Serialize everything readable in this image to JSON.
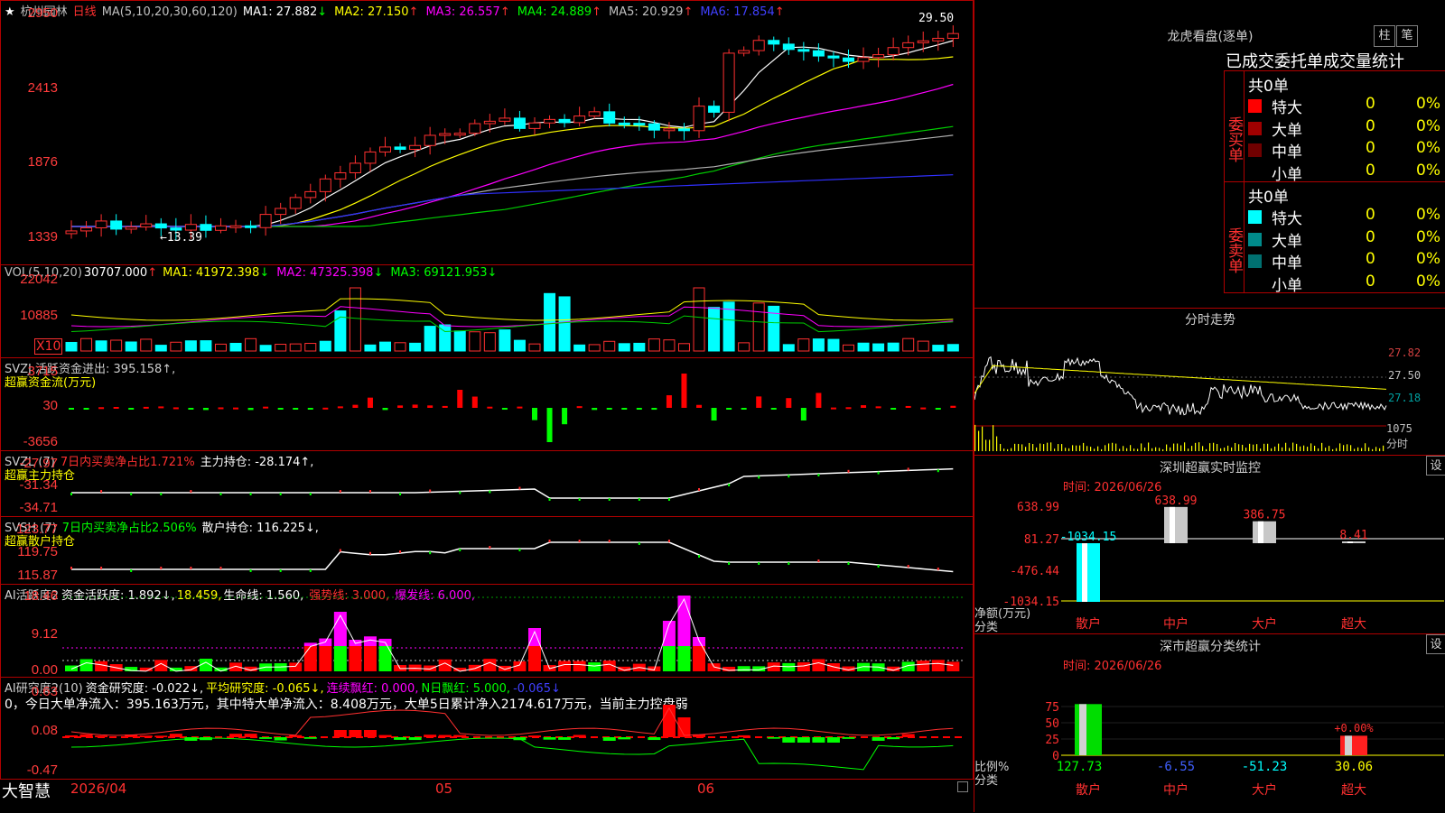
{
  "stock": {
    "name": "杭州园林",
    "period": "日线",
    "star": "★"
  },
  "ma_header": {
    "label": "MA(5,10,20,30,60,120)",
    "items": [
      {
        "text": "MA1: 27.882",
        "arrow": "↓",
        "color": "#ffffff"
      },
      {
        "text": "MA2: 27.150",
        "arrow": "↑",
        "color": "#ffff00"
      },
      {
        "text": "MA3: 26.557",
        "arrow": "↑",
        "color": "#ff00ff"
      },
      {
        "text": "MA4: 24.889",
        "arrow": "↑",
        "color": "#00ff00"
      },
      {
        "text": "MA5: 20.929",
        "arrow": "↑",
        "color": "#c0c0c0"
      },
      {
        "text": "MA6: 17.854",
        "arrow": "↑",
        "color": "#4040ff"
      }
    ],
    "high_mark": "29.50",
    "low_mark": "←13.39"
  },
  "price_axis": [
    "2950",
    "2413",
    "1876",
    "1339"
  ],
  "vol_header": {
    "label": "VOL(5,10,20)",
    "value": "30707.000",
    "arrow": "↑",
    "items": [
      {
        "text": "MA1: 41972.398",
        "arrow": "↓",
        "color": "#ffff00"
      },
      {
        "text": "MA2: 47325.398",
        "arrow": "↓",
        "color": "#ff00ff"
      },
      {
        "text": "MA3: 69121.953",
        "arrow": "↓",
        "color": "#00ff00"
      }
    ]
  },
  "vol_axis": [
    "22042",
    "10885"
  ],
  "vol_unit": "X10",
  "svzj": {
    "line1": "SVZJ  活跃资金进出: 395.158↑,",
    "line2": "超赢资金流(万元)",
    "axis": [
      "3715",
      "30",
      "-3656"
    ]
  },
  "svzl": {
    "line1a": "SVZL (7)",
    "line1b": "7日内买卖净占比1.721%",
    "line1c": "主力持仓: -28.174↑,",
    "line2": "超赢主力持仓",
    "axis": [
      "-27.97",
      "-31.34",
      "-34.71"
    ]
  },
  "svsh": {
    "line1a": "SVSH (7)",
    "line1b": "7日内买卖净占比2.506%",
    "line1c": "散户持仓: 116.225↓,",
    "line2": "超赢散户持仓",
    "axis": [
      "123.77",
      "119.75",
      "115.87"
    ]
  },
  "ai1": {
    "a": "AI活跃度2",
    "b": "资金活跃度: 1.892↓,",
    "c": "18.459,",
    "d": "生命线: 1.560,",
    "e": "强势线: 3.000,",
    "f": "爆发线: 6.000,",
    "axis": [
      "18.46",
      "9.12",
      "0.00"
    ]
  },
  "ai2": {
    "a": "AI研究度2(10)",
    "b": "资金研究度: -0.022↓,",
    "c": "平均研究度: -0.065↓,",
    "d": "连续飘红: 0.000,",
    "e": "N日飘红: 5.000,",
    "f": "-0.065↓",
    "line2": "0，今日大单净流入：395.163万元，其中特大单净流入：8.408万元，大单5日累计净入2174.617万元，当前主力控盘弱",
    "axis": [
      "0.63",
      "0.08",
      "-0.47"
    ]
  },
  "bottom": {
    "brand": "大智慧",
    "date": "2026/04",
    "m05": "05",
    "m06": "06"
  },
  "lhb": {
    "title": "龙虎看盘(逐单)",
    "btn1": "柱",
    "btn2": "笔",
    "subtitle": "已成交委托单成交量统计",
    "buy": {
      "label": "委买单",
      "total": "共0单",
      "rows": [
        {
          "name": "特大",
          "v": "0",
          "p": "0%",
          "color": "#ff0000"
        },
        {
          "name": "大单",
          "v": "0",
          "p": "0%",
          "color": "#a00000"
        },
        {
          "name": "中单",
          "v": "0",
          "p": "0%",
          "color": "#700000"
        },
        {
          "name": "小单",
          "v": "0",
          "p": "0%",
          "color": ""
        }
      ]
    },
    "sell": {
      "label": "委卖单",
      "total": "共0单",
      "rows": [
        {
          "name": "特大",
          "v": "0",
          "p": "0%",
          "color": "#00ffff"
        },
        {
          "name": "大单",
          "v": "0",
          "p": "0%",
          "color": "#008b8b"
        },
        {
          "name": "中单",
          "v": "0",
          "p": "0%",
          "color": "#007070"
        },
        {
          "name": "小单",
          "v": "0",
          "p": "0%",
          "color": ""
        }
      ]
    }
  },
  "intraday": {
    "title": "分时走势",
    "axis": [
      "27.82",
      "27.50",
      "27.18"
    ],
    "vol": "1075",
    "unit": "分时"
  },
  "monitor": {
    "title": "深圳超赢实时监控",
    "set": "设",
    "time": "时间: 2026/06/26",
    "axis": [
      "638.99",
      "81.27",
      "-476.44",
      "-1034.15"
    ],
    "ylabel": "净额(万元)",
    "xlabel": "分类",
    "cats": [
      "散户",
      "中户",
      "大户",
      "超大"
    ],
    "values": [
      "-1034.15",
      "638.99",
      "386.75",
      "8.41"
    ]
  },
  "stats": {
    "title": "深市超赢分类统计",
    "set": "设",
    "time": "时间: 2026/06/26",
    "axis": [
      "75",
      "50",
      "25",
      "0"
    ],
    "ylabel": "比例%",
    "xlabel": "分类",
    "cats": [
      "散户",
      "中户",
      "大户",
      "超大"
    ],
    "values": [
      "127.73",
      "-6.55",
      "-51.23",
      "30.06"
    ],
    "pct": "+0.00%"
  }
}
